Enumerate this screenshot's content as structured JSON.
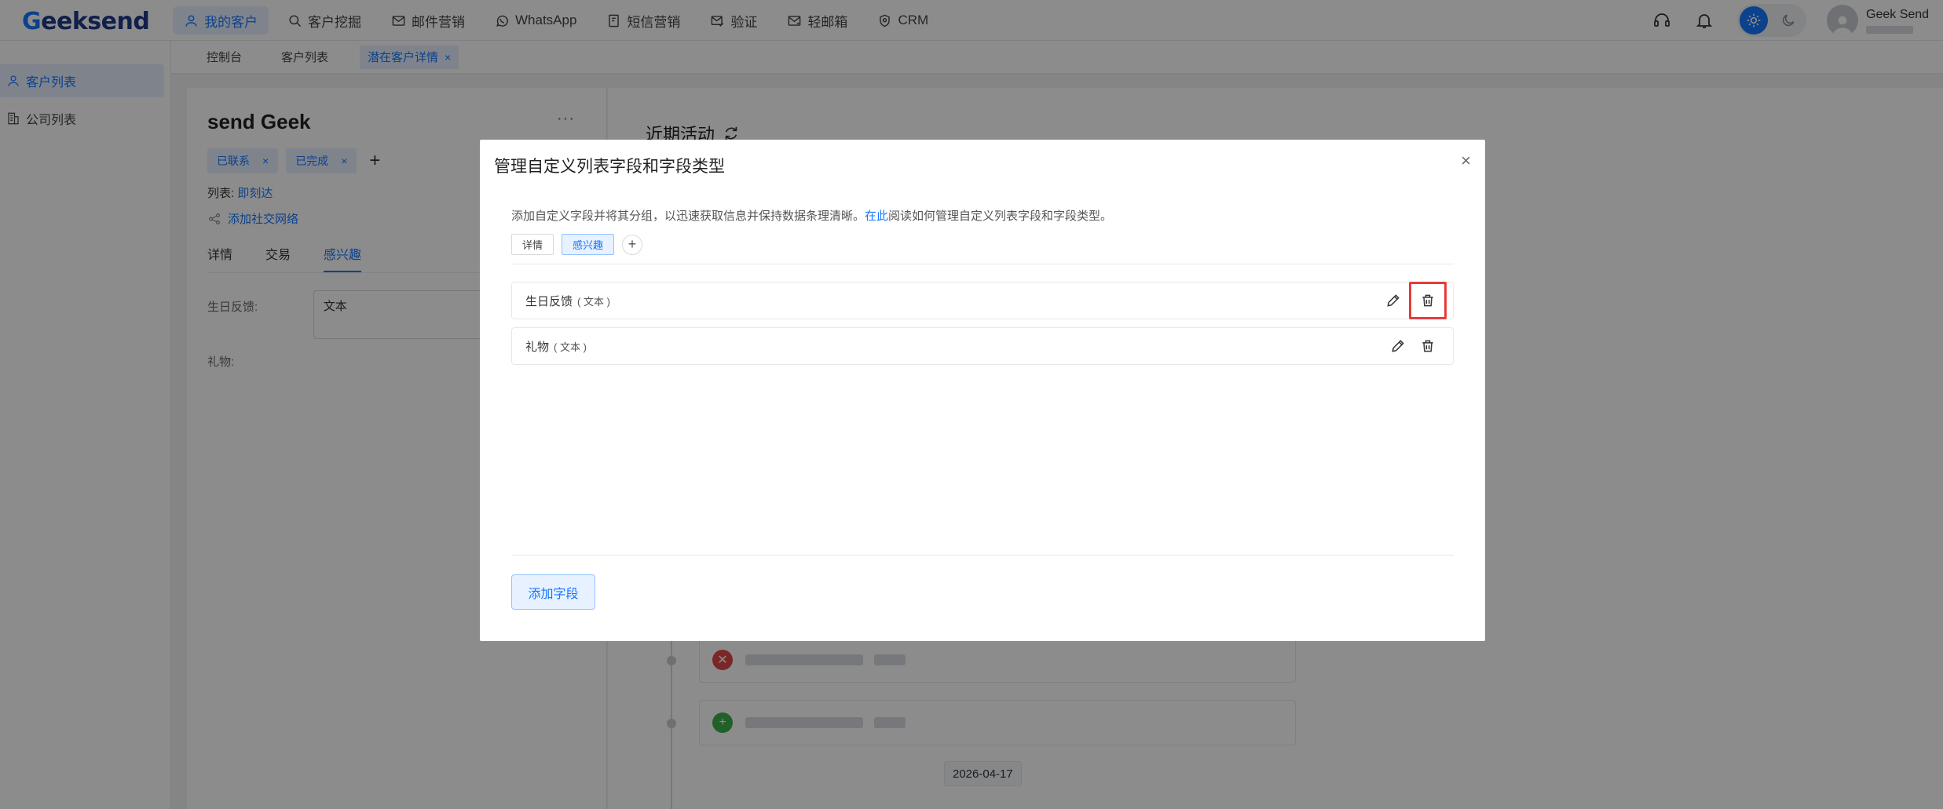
{
  "app": {
    "logo_text": "eeksend",
    "logo_letter": "G"
  },
  "nav": {
    "items": [
      {
        "label": "我的客户",
        "icon": "user-icon",
        "active": true
      },
      {
        "label": "客户挖掘",
        "icon": "search-icon",
        "active": false
      },
      {
        "label": "邮件营销",
        "icon": "mail-icon",
        "active": false
      },
      {
        "label": "WhatsApp",
        "icon": "whatsapp-icon",
        "active": false
      },
      {
        "label": "短信营销",
        "icon": "sms-icon",
        "active": false
      },
      {
        "label": "验证",
        "icon": "verify-mail-icon",
        "active": false
      },
      {
        "label": "轻邮箱",
        "icon": "light-mail-icon",
        "active": false
      },
      {
        "label": "CRM",
        "icon": "crm-shield-icon",
        "active": false
      }
    ]
  },
  "user": {
    "name": "Geek Send"
  },
  "sidebar": {
    "items": [
      {
        "label": "客户列表",
        "icon": "user-icon",
        "active": true
      },
      {
        "label": "公司列表",
        "icon": "building-icon",
        "active": false
      }
    ]
  },
  "page_tabs": [
    {
      "label": "控制台",
      "active": false
    },
    {
      "label": "客户列表",
      "active": false
    },
    {
      "label": "潜在客户详情",
      "active": true,
      "close": "×"
    }
  ],
  "detail": {
    "name": "send Geek",
    "more": "···",
    "tags": [
      {
        "label": "已联系",
        "close": "×"
      },
      {
        "label": "已完成",
        "close": "×"
      }
    ],
    "tag_add": "+",
    "list_prefix": "列表:",
    "list_value": "即刻达",
    "social_link": "添加社交网络",
    "sub_tabs": [
      {
        "label": "详情",
        "active": false
      },
      {
        "label": "交易",
        "active": false
      },
      {
        "label": "感兴趣",
        "active": true
      }
    ],
    "fields": [
      {
        "label": "生日反馈:",
        "value": "文本"
      },
      {
        "label": "礼物:",
        "value": ""
      }
    ]
  },
  "activity": {
    "title": "近期活动",
    "date_chip": "2026-04-17",
    "colors": {
      "delete": "#e04848",
      "add": "#3cb04a"
    }
  },
  "modal": {
    "title": "管理自定义列表字段和字段类型",
    "close": "×",
    "desc_before": "添加自定义字段并将其分组，以迅速获取信息并保持数据条理清晰。",
    "desc_link": "在此",
    "desc_after": "阅读如何管理自定义列表字段和字段类型。",
    "groups": [
      {
        "label": "详情",
        "active": false
      },
      {
        "label": "感兴趣",
        "active": true
      }
    ],
    "group_add": "+",
    "fields": [
      {
        "name": "生日反馈",
        "type": "( 文本 )",
        "delete_highlighted": true
      },
      {
        "name": "礼物",
        "type": "( 文本 )",
        "delete_highlighted": false
      }
    ],
    "add_button": "添加字段"
  },
  "colors": {
    "accent": "#1677ff",
    "highlight": "#e63b3b"
  }
}
